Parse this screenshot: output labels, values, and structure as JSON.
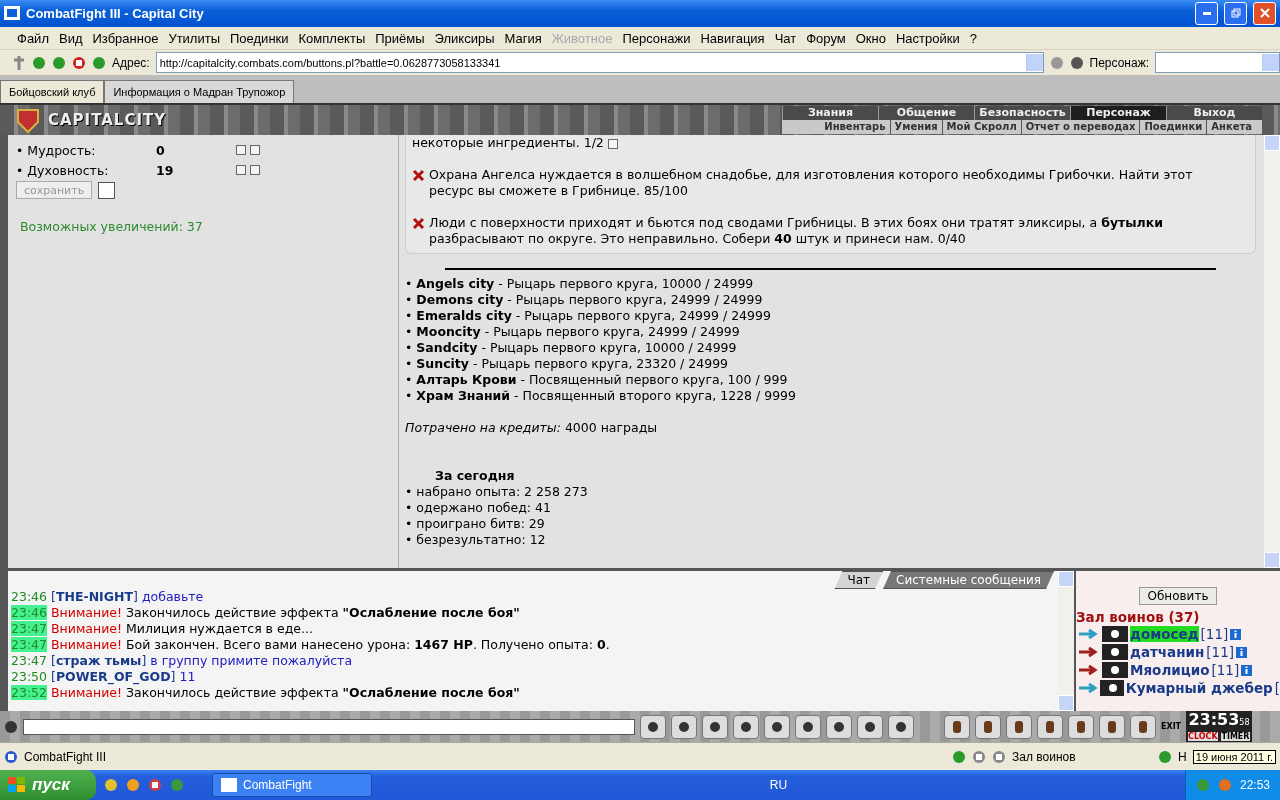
{
  "window": {
    "title": "CombatFight III - Capital City"
  },
  "menu": [
    {
      "label": "Файл",
      "disabled": false
    },
    {
      "label": "Вид",
      "disabled": false
    },
    {
      "label": "Избранное",
      "disabled": false
    },
    {
      "label": "Утилиты",
      "disabled": false
    },
    {
      "label": "Поединки",
      "disabled": false
    },
    {
      "label": "Комплекты",
      "disabled": false
    },
    {
      "label": "Приёмы",
      "disabled": false
    },
    {
      "label": "Эликсиры",
      "disabled": false
    },
    {
      "label": "Магия",
      "disabled": false
    },
    {
      "label": "Животное",
      "disabled": true
    },
    {
      "label": "Персонажи",
      "disabled": false
    },
    {
      "label": "Навигация",
      "disabled": false
    },
    {
      "label": "Чат",
      "disabled": false
    },
    {
      "label": "Форум",
      "disabled": false
    },
    {
      "label": "Окно",
      "disabled": false
    },
    {
      "label": "Настройки",
      "disabled": false
    },
    {
      "label": "?",
      "disabled": false
    }
  ],
  "address": {
    "label": "Адрес:",
    "url": "http://capitalcity.combats.com/buttons.pl?battle=0.0628773058133341",
    "character_label": "Персонаж:"
  },
  "tabs": [
    {
      "label": "Бойцовский клуб",
      "selected": true
    },
    {
      "label": "Информация о Мадран Трупожор",
      "selected": false
    }
  ],
  "game_header": {
    "logo": "CAPITALCITY",
    "nav": [
      {
        "label": "Знания",
        "selected": false
      },
      {
        "label": "Общение",
        "selected": false
      },
      {
        "label": "Безопасность",
        "selected": false
      },
      {
        "label": "Персонаж",
        "selected": true
      },
      {
        "label": "Выход",
        "selected": false
      }
    ],
    "subnav": [
      "Инвентарь",
      "Умения",
      "Мой Скролл",
      "Отчет о переводах",
      "Поединки",
      "Анкета"
    ]
  },
  "stats": [
    {
      "name": "• Мудрость:",
      "value": "0"
    },
    {
      "name": "• Духовность:",
      "value": "19"
    }
  ],
  "save_button": "сохранить",
  "save_checkbox": {
    "checked": false
  },
  "increases": "Возможных увеличений: 37",
  "quests": [
    {
      "kind": "continued",
      "text": "некоторые ингредиенты. 1/2"
    },
    {
      "kind": "failed",
      "text": "Охрана Ангелса нуждается в волшебном снадобье, для изготовления которого необходимы Грибочки. Найти этот ресурс вы сможете в Грибнице. 85/100"
    },
    {
      "kind": "failed",
      "text": "Люди с поверхности приходят и бьются под сводами Грибницы. В этих боях они тратят эликсиры, а **бутылки** разбрасывают по округе. Это неправильно. Собери **40** штук и принеси нам. 0/40"
    }
  ],
  "reputation": [
    "• **Angels city** - Рыцарь первого круга, 10000 / 24999",
    "• **Demons city** - Рыцарь первого круга, 24999 / 24999",
    "• **Emeralds city** - Рыцарь первого круга, 24999 / 24999",
    "• **Mooncity** - Рыцарь первого круга, 24999 / 24999",
    "• **Sandcity** - Рыцарь первого круга, 10000 / 24999",
    "• **Suncity** - Рыцарь первого круга, 23320 / 24999",
    "• **Алтарь Крови** - Посвященный первого круга, 100 / 999",
    "• **Храм Знаний** - Посвященный второго круга, 1228 / 9999"
  ],
  "credits": "*Потрачено на кредиты:* 4000 награды",
  "today": {
    "title": "За сегодня",
    "items": [
      "• набрано опыта: 2 258 273",
      "• одержано побед: 41",
      "• проиграно битв: 29",
      "• безрезультатно: 12"
    ]
  },
  "chat_tabs": [
    {
      "label": "Чат",
      "selected": true
    },
    {
      "label": "Системные сообщения",
      "selected": false
    }
  ],
  "chat": [
    {
      "time": "23:46",
      "highlighted": false,
      "kind": "private",
      "sender": "[**THE-NIGHT**]",
      "text": "добавьте"
    },
    {
      "time": "23:46",
      "highlighted": true,
      "kind": "system",
      "sender": "Внимание!",
      "text": "Закончилось действие эффекта **\"Ослабление после боя\"**"
    },
    {
      "time": "23:47",
      "highlighted": true,
      "kind": "system",
      "sender": "Внимание!",
      "text": "Милиция нуждается в еде..."
    },
    {
      "time": "23:47",
      "highlighted": true,
      "kind": "system",
      "sender": "Внимание!",
      "text": "Бой закончен. Всего вами нанесено урона: **1467 HP**. Получено опыта: **0**."
    },
    {
      "time": "23:47",
      "highlighted": false,
      "kind": "private",
      "sender": "[**страж тьмы**]",
      "text": "в группу примите пожалуйста"
    },
    {
      "time": "23:50",
      "highlighted": false,
      "kind": "private",
      "sender": "[**POWER_OF_GOD**]",
      "text": "11"
    },
    {
      "time": "23:52",
      "highlighted": true,
      "kind": "system",
      "sender": "Внимание!",
      "text": "Закончилось действие эффекта **\"Ослабление после боя\"**"
    }
  ],
  "room": {
    "refresh_button": "Обновить",
    "title": "Зал воинов (37)",
    "players": [
      {
        "name": "домосед",
        "level": "[11]",
        "highlighted": true
      },
      {
        "name": "датчанин",
        "level": "[11]",
        "highlighted": false
      },
      {
        "name": "Мяолицио",
        "level": "[11]",
        "highlighted": false
      },
      {
        "name": "Кумарный джебер",
        "level": "[",
        "highlighted": false
      }
    ]
  },
  "clock": {
    "time": "23:53",
    "seconds": "58",
    "exit": "EXIT",
    "clock_label": "CLOCK",
    "timer_label": "TIMER"
  },
  "status_bar": {
    "title": "CombatFight III",
    "location": "Зал воинов",
    "letter": "Н",
    "tooltip": "19 июня 2011 г."
  },
  "taskbar": {
    "start": "пуск",
    "task": "CombatFight",
    "language": "RU",
    "time": "22:53"
  }
}
